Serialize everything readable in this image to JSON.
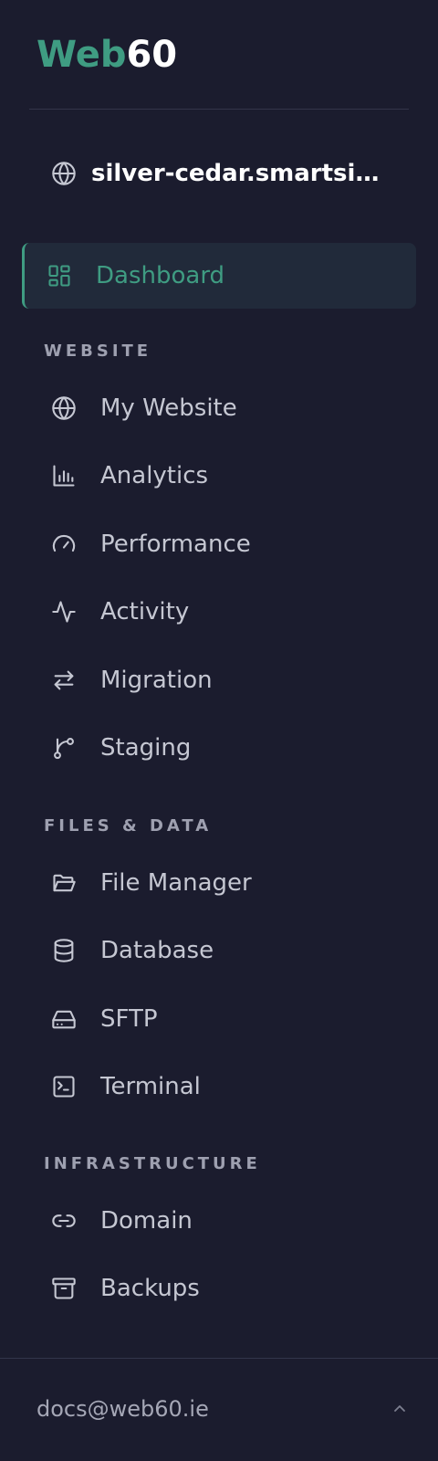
{
  "brand": {
    "part1": "Web",
    "part2": "60",
    "accent": "#3f9c82"
  },
  "site": {
    "name": "silver-cedar.smartsi…",
    "icon": "globe-icon"
  },
  "nav": {
    "dashboard": {
      "label": "Dashboard",
      "icon": "dashboard-icon",
      "active": true
    },
    "sections": [
      {
        "title": "WEBSITE",
        "items": [
          {
            "label": "My Website",
            "icon": "globe-icon"
          },
          {
            "label": "Analytics",
            "icon": "bar-chart-icon"
          },
          {
            "label": "Performance",
            "icon": "gauge-icon"
          },
          {
            "label": "Activity",
            "icon": "activity-icon"
          },
          {
            "label": "Migration",
            "icon": "arrows-swap-icon"
          },
          {
            "label": "Staging",
            "icon": "git-branch-icon"
          }
        ]
      },
      {
        "title": "FILES & DATA",
        "items": [
          {
            "label": "File Manager",
            "icon": "folder-open-icon"
          },
          {
            "label": "Database",
            "icon": "database-icon"
          },
          {
            "label": "SFTP",
            "icon": "hard-drive-icon"
          },
          {
            "label": "Terminal",
            "icon": "terminal-icon"
          }
        ]
      },
      {
        "title": "INFRASTRUCTURE",
        "items": [
          {
            "label": "Domain",
            "icon": "link-icon"
          },
          {
            "label": "Backups",
            "icon": "archive-icon"
          }
        ]
      }
    ]
  },
  "account": {
    "email": "docs@web60.ie",
    "icon": "chevron-up-icon"
  }
}
